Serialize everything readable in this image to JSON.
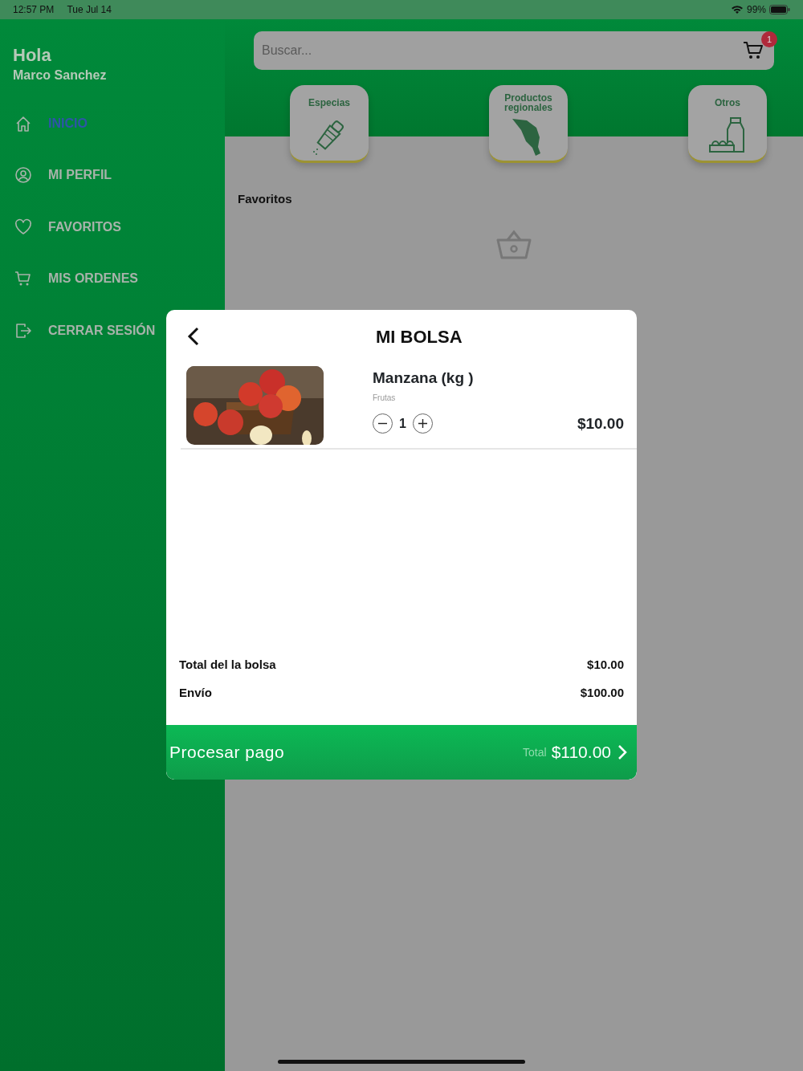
{
  "status_bar": {
    "time": "12:57 PM",
    "date": "Tue Jul 14",
    "battery": "99%"
  },
  "sidebar": {
    "greeting": "Hola",
    "user": "Marco Sanchez",
    "items": [
      {
        "label": "INICIO",
        "selected": true
      },
      {
        "label": "MI PERFIL",
        "selected": false
      },
      {
        "label": "FAVORITOS",
        "selected": false
      },
      {
        "label": "MIS ORDENES",
        "selected": false
      },
      {
        "label": "CERRAR SESIÓN",
        "selected": false
      }
    ]
  },
  "search": {
    "placeholder": "Buscar...",
    "cart_badge": "1"
  },
  "categories": [
    {
      "label": "Especias"
    },
    {
      "label": "Productos regionales"
    },
    {
      "label": "Otros"
    }
  ],
  "favorites": {
    "title": "Favoritos"
  },
  "bag": {
    "title": "MI BOLSA",
    "items": [
      {
        "kind": "picture",
        "name": "Manzana (kg )",
        "category": "Frutas",
        "quantity": "1",
        "price": "$10.00"
      }
    ],
    "summary": [
      {
        "label": "Total del la bolsa",
        "value": "$10.00"
      },
      {
        "label": "Envío",
        "value": "$100.00"
      }
    ],
    "checkout": {
      "label": "Procesar pago",
      "total_label": "Total",
      "total": "$110.00"
    }
  }
}
